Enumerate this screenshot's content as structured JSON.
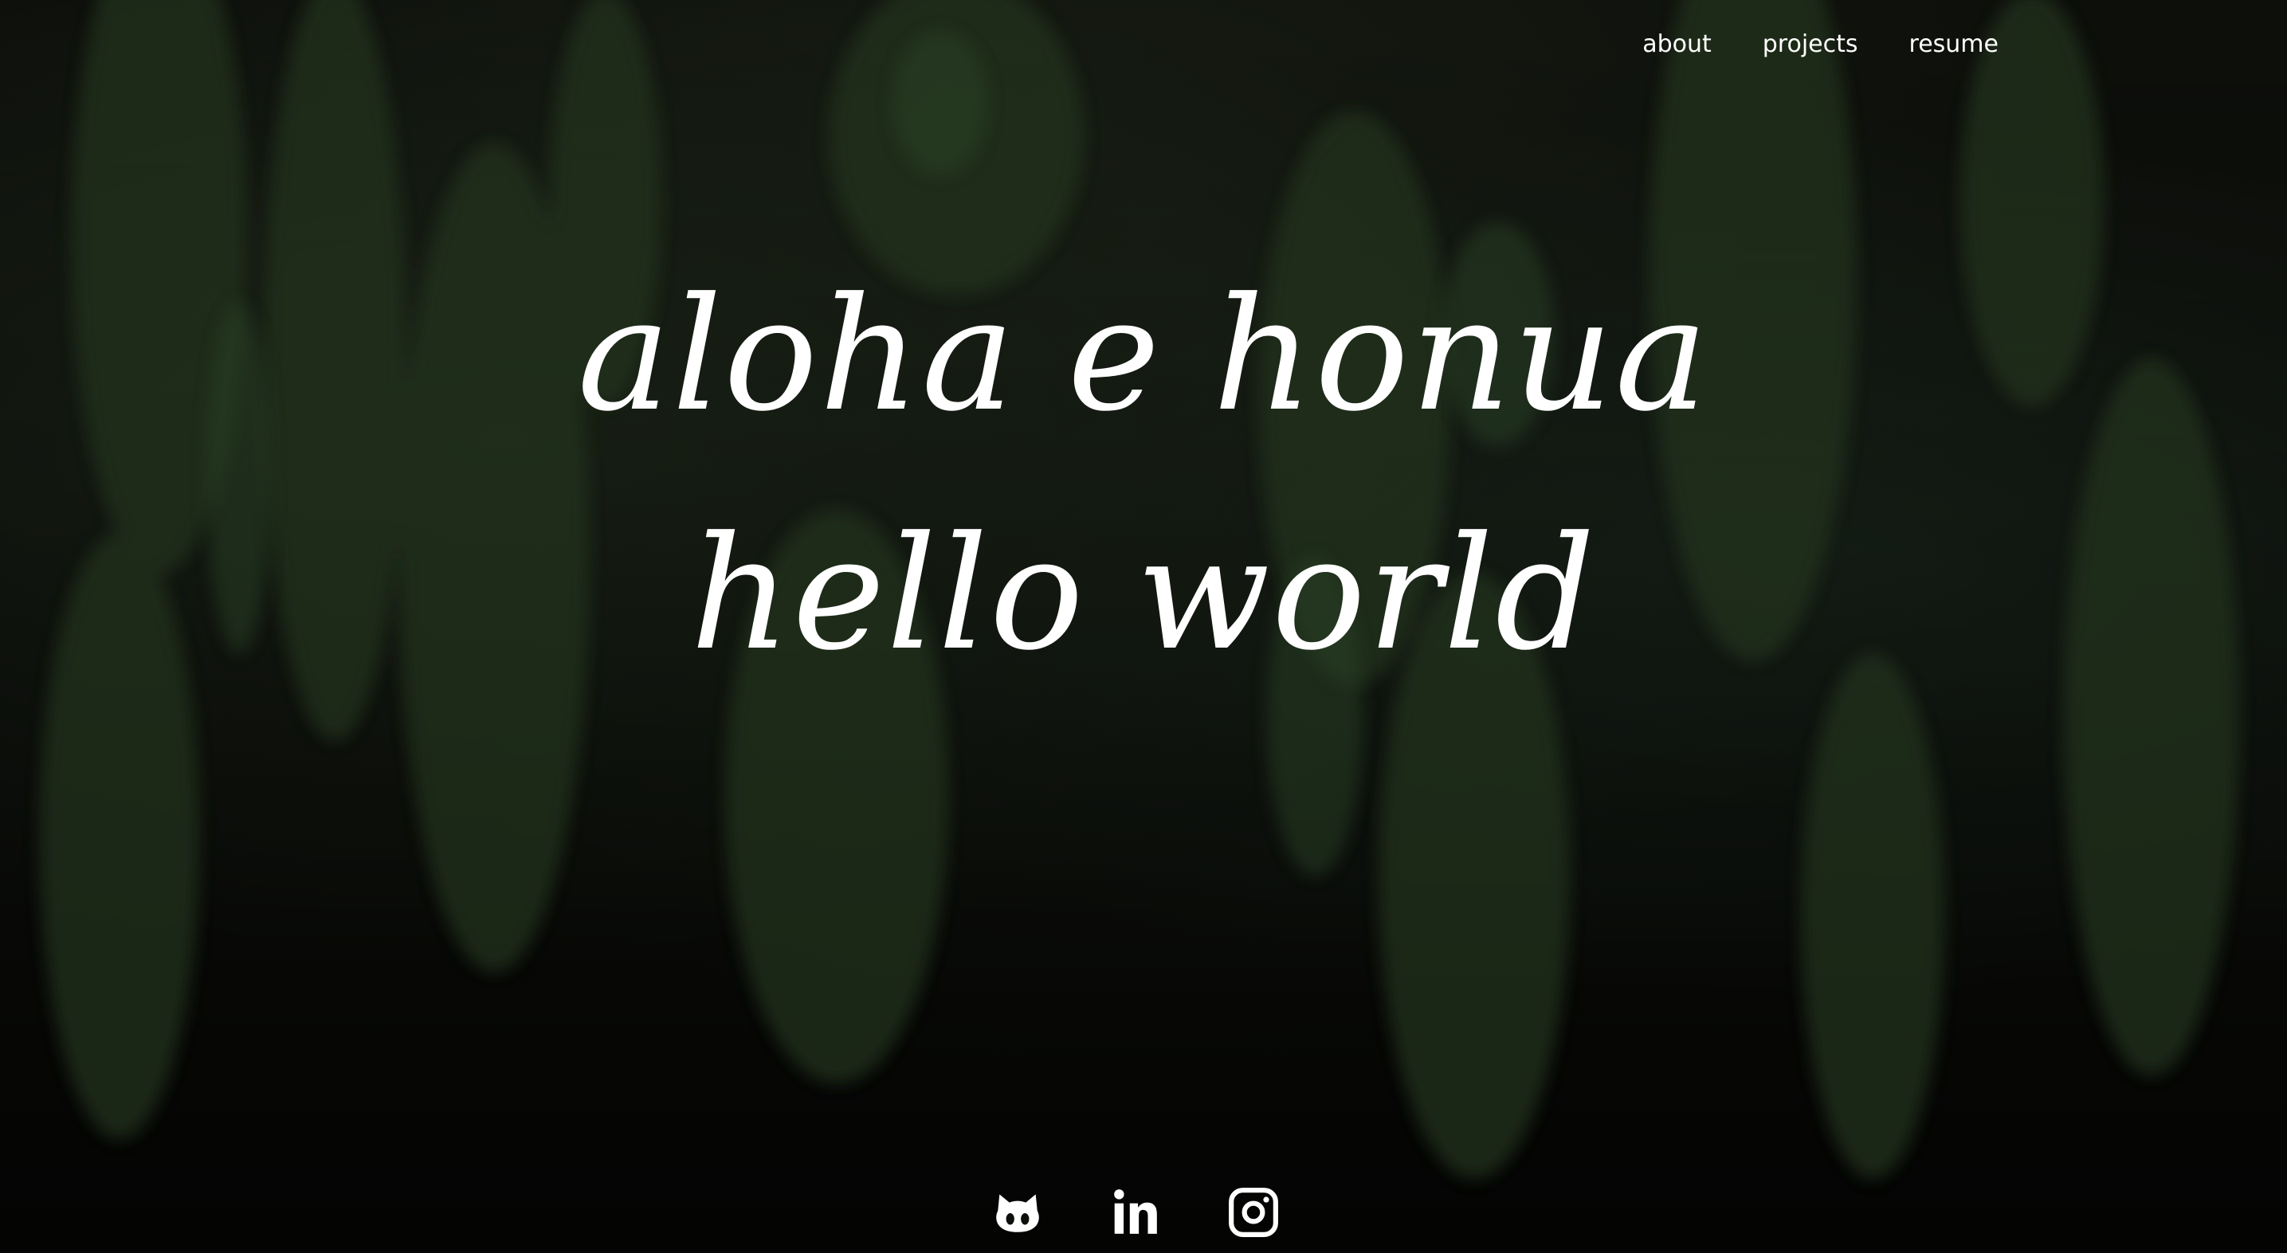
{
  "nav": {
    "items": [
      {
        "label": "about"
      },
      {
        "label": "projects"
      },
      {
        "label": "resume"
      }
    ]
  },
  "hero": {
    "line1": "aloha e honua",
    "line2": "hello world"
  },
  "social": {
    "icons": [
      "github-icon",
      "linkedin-icon",
      "instagram-icon"
    ]
  },
  "colors": {
    "background": "#0d0f0b",
    "foliage": "#1f2c1d",
    "text": "#ffffff"
  }
}
